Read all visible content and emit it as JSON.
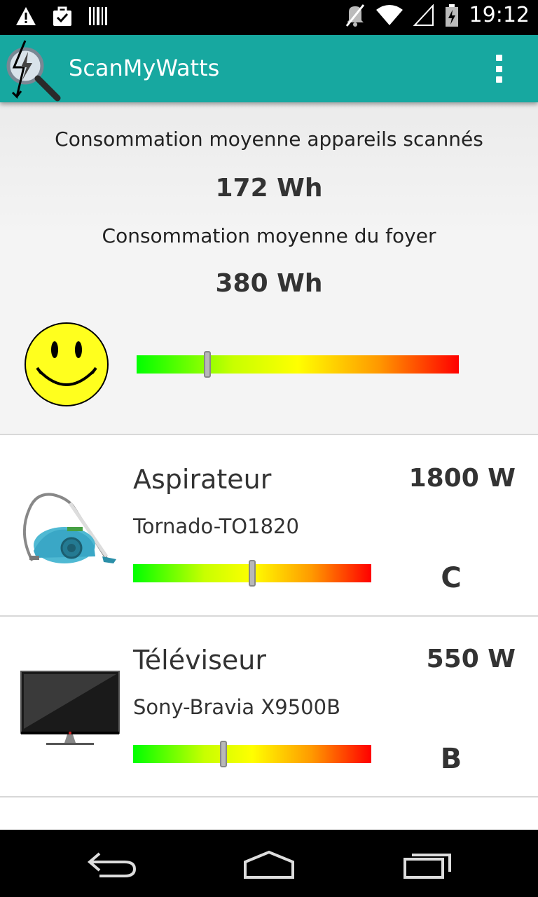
{
  "status_bar": {
    "time": "19:12",
    "icons": [
      "warning-icon",
      "bag-icon",
      "barcode-icon",
      "mute-icon",
      "wifi-icon",
      "signal-icon",
      "battery-icon"
    ]
  },
  "app_bar": {
    "title": "ScanMyWatts",
    "color": "#17a8a0"
  },
  "summary": {
    "scanned_label": "Consommation moyenne appareils scannés",
    "scanned_value": "172 Wh",
    "home_label": "Consommation moyenne du foyer",
    "home_value": "380 Wh",
    "mood_icon": "smiley-icon",
    "gauge_level": 0.22
  },
  "appliances": [
    {
      "name": "Aspirateur",
      "power": "1800 W",
      "model": "Tornado-TO1820",
      "grade": "C",
      "gauge_level": 0.5,
      "icon": "vacuum-cleaner-icon"
    },
    {
      "name": "Téléviseur",
      "power": "550 W",
      "model": "Sony-Bravia X9500B",
      "grade": "B",
      "gauge_level": 0.38,
      "icon": "television-icon"
    }
  ],
  "nav_bar": {
    "buttons": [
      "back-icon",
      "home-icon",
      "recents-icon"
    ]
  }
}
